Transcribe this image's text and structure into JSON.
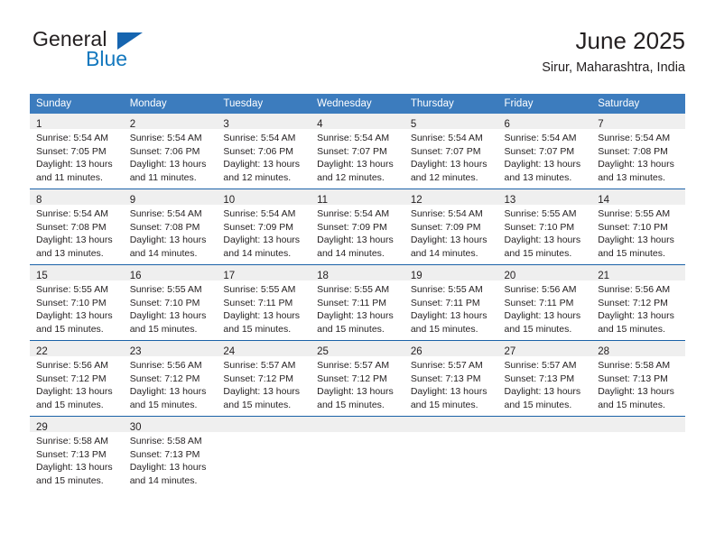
{
  "brand": {
    "name_part1": "General",
    "name_part2": "Blue",
    "logo_icon": "triangle-logo-icon",
    "color_primary": "#1378be",
    "color_text": "#231f20"
  },
  "header": {
    "title": "June 2025",
    "subtitle": "Sirur, Maharashtra, India"
  },
  "theme": {
    "header_blue": "#3c7cbe",
    "separator_blue": "#1b62a8",
    "daynum_band": "#efefef"
  },
  "calendar": {
    "weekdays": [
      "Sunday",
      "Monday",
      "Tuesday",
      "Wednesday",
      "Thursday",
      "Friday",
      "Saturday"
    ],
    "weeks": [
      [
        {
          "day": "1",
          "sunrise": "Sunrise: 5:54 AM",
          "sunset": "Sunset: 7:05 PM",
          "daylight_line1": "Daylight: 13 hours",
          "daylight_line2": "and 11 minutes."
        },
        {
          "day": "2",
          "sunrise": "Sunrise: 5:54 AM",
          "sunset": "Sunset: 7:06 PM",
          "daylight_line1": "Daylight: 13 hours",
          "daylight_line2": "and 11 minutes."
        },
        {
          "day": "3",
          "sunrise": "Sunrise: 5:54 AM",
          "sunset": "Sunset: 7:06 PM",
          "daylight_line1": "Daylight: 13 hours",
          "daylight_line2": "and 12 minutes."
        },
        {
          "day": "4",
          "sunrise": "Sunrise: 5:54 AM",
          "sunset": "Sunset: 7:07 PM",
          "daylight_line1": "Daylight: 13 hours",
          "daylight_line2": "and 12 minutes."
        },
        {
          "day": "5",
          "sunrise": "Sunrise: 5:54 AM",
          "sunset": "Sunset: 7:07 PM",
          "daylight_line1": "Daylight: 13 hours",
          "daylight_line2": "and 12 minutes."
        },
        {
          "day": "6",
          "sunrise": "Sunrise: 5:54 AM",
          "sunset": "Sunset: 7:07 PM",
          "daylight_line1": "Daylight: 13 hours",
          "daylight_line2": "and 13 minutes."
        },
        {
          "day": "7",
          "sunrise": "Sunrise: 5:54 AM",
          "sunset": "Sunset: 7:08 PM",
          "daylight_line1": "Daylight: 13 hours",
          "daylight_line2": "and 13 minutes."
        }
      ],
      [
        {
          "day": "8",
          "sunrise": "Sunrise: 5:54 AM",
          "sunset": "Sunset: 7:08 PM",
          "daylight_line1": "Daylight: 13 hours",
          "daylight_line2": "and 13 minutes."
        },
        {
          "day": "9",
          "sunrise": "Sunrise: 5:54 AM",
          "sunset": "Sunset: 7:08 PM",
          "daylight_line1": "Daylight: 13 hours",
          "daylight_line2": "and 14 minutes."
        },
        {
          "day": "10",
          "sunrise": "Sunrise: 5:54 AM",
          "sunset": "Sunset: 7:09 PM",
          "daylight_line1": "Daylight: 13 hours",
          "daylight_line2": "and 14 minutes."
        },
        {
          "day": "11",
          "sunrise": "Sunrise: 5:54 AM",
          "sunset": "Sunset: 7:09 PM",
          "daylight_line1": "Daylight: 13 hours",
          "daylight_line2": "and 14 minutes."
        },
        {
          "day": "12",
          "sunrise": "Sunrise: 5:54 AM",
          "sunset": "Sunset: 7:09 PM",
          "daylight_line1": "Daylight: 13 hours",
          "daylight_line2": "and 14 minutes."
        },
        {
          "day": "13",
          "sunrise": "Sunrise: 5:55 AM",
          "sunset": "Sunset: 7:10 PM",
          "daylight_line1": "Daylight: 13 hours",
          "daylight_line2": "and 15 minutes."
        },
        {
          "day": "14",
          "sunrise": "Sunrise: 5:55 AM",
          "sunset": "Sunset: 7:10 PM",
          "daylight_line1": "Daylight: 13 hours",
          "daylight_line2": "and 15 minutes."
        }
      ],
      [
        {
          "day": "15",
          "sunrise": "Sunrise: 5:55 AM",
          "sunset": "Sunset: 7:10 PM",
          "daylight_line1": "Daylight: 13 hours",
          "daylight_line2": "and 15 minutes."
        },
        {
          "day": "16",
          "sunrise": "Sunrise: 5:55 AM",
          "sunset": "Sunset: 7:10 PM",
          "daylight_line1": "Daylight: 13 hours",
          "daylight_line2": "and 15 minutes."
        },
        {
          "day": "17",
          "sunrise": "Sunrise: 5:55 AM",
          "sunset": "Sunset: 7:11 PM",
          "daylight_line1": "Daylight: 13 hours",
          "daylight_line2": "and 15 minutes."
        },
        {
          "day": "18",
          "sunrise": "Sunrise: 5:55 AM",
          "sunset": "Sunset: 7:11 PM",
          "daylight_line1": "Daylight: 13 hours",
          "daylight_line2": "and 15 minutes."
        },
        {
          "day": "19",
          "sunrise": "Sunrise: 5:55 AM",
          "sunset": "Sunset: 7:11 PM",
          "daylight_line1": "Daylight: 13 hours",
          "daylight_line2": "and 15 minutes."
        },
        {
          "day": "20",
          "sunrise": "Sunrise: 5:56 AM",
          "sunset": "Sunset: 7:11 PM",
          "daylight_line1": "Daylight: 13 hours",
          "daylight_line2": "and 15 minutes."
        },
        {
          "day": "21",
          "sunrise": "Sunrise: 5:56 AM",
          "sunset": "Sunset: 7:12 PM",
          "daylight_line1": "Daylight: 13 hours",
          "daylight_line2": "and 15 minutes."
        }
      ],
      [
        {
          "day": "22",
          "sunrise": "Sunrise: 5:56 AM",
          "sunset": "Sunset: 7:12 PM",
          "daylight_line1": "Daylight: 13 hours",
          "daylight_line2": "and 15 minutes."
        },
        {
          "day": "23",
          "sunrise": "Sunrise: 5:56 AM",
          "sunset": "Sunset: 7:12 PM",
          "daylight_line1": "Daylight: 13 hours",
          "daylight_line2": "and 15 minutes."
        },
        {
          "day": "24",
          "sunrise": "Sunrise: 5:57 AM",
          "sunset": "Sunset: 7:12 PM",
          "daylight_line1": "Daylight: 13 hours",
          "daylight_line2": "and 15 minutes."
        },
        {
          "day": "25",
          "sunrise": "Sunrise: 5:57 AM",
          "sunset": "Sunset: 7:12 PM",
          "daylight_line1": "Daylight: 13 hours",
          "daylight_line2": "and 15 minutes."
        },
        {
          "day": "26",
          "sunrise": "Sunrise: 5:57 AM",
          "sunset": "Sunset: 7:13 PM",
          "daylight_line1": "Daylight: 13 hours",
          "daylight_line2": "and 15 minutes."
        },
        {
          "day": "27",
          "sunrise": "Sunrise: 5:57 AM",
          "sunset": "Sunset: 7:13 PM",
          "daylight_line1": "Daylight: 13 hours",
          "daylight_line2": "and 15 minutes."
        },
        {
          "day": "28",
          "sunrise": "Sunrise: 5:58 AM",
          "sunset": "Sunset: 7:13 PM",
          "daylight_line1": "Daylight: 13 hours",
          "daylight_line2": "and 15 minutes."
        }
      ],
      [
        {
          "day": "29",
          "sunrise": "Sunrise: 5:58 AM",
          "sunset": "Sunset: 7:13 PM",
          "daylight_line1": "Daylight: 13 hours",
          "daylight_line2": "and 15 minutes."
        },
        {
          "day": "30",
          "sunrise": "Sunrise: 5:58 AM",
          "sunset": "Sunset: 7:13 PM",
          "daylight_line1": "Daylight: 13 hours",
          "daylight_line2": "and 14 minutes."
        },
        {
          "day": "",
          "sunrise": "",
          "sunset": "",
          "daylight_line1": "",
          "daylight_line2": ""
        },
        {
          "day": "",
          "sunrise": "",
          "sunset": "",
          "daylight_line1": "",
          "daylight_line2": ""
        },
        {
          "day": "",
          "sunrise": "",
          "sunset": "",
          "daylight_line1": "",
          "daylight_line2": ""
        },
        {
          "day": "",
          "sunrise": "",
          "sunset": "",
          "daylight_line1": "",
          "daylight_line2": ""
        },
        {
          "day": "",
          "sunrise": "",
          "sunset": "",
          "daylight_line1": "",
          "daylight_line2": ""
        }
      ]
    ]
  }
}
